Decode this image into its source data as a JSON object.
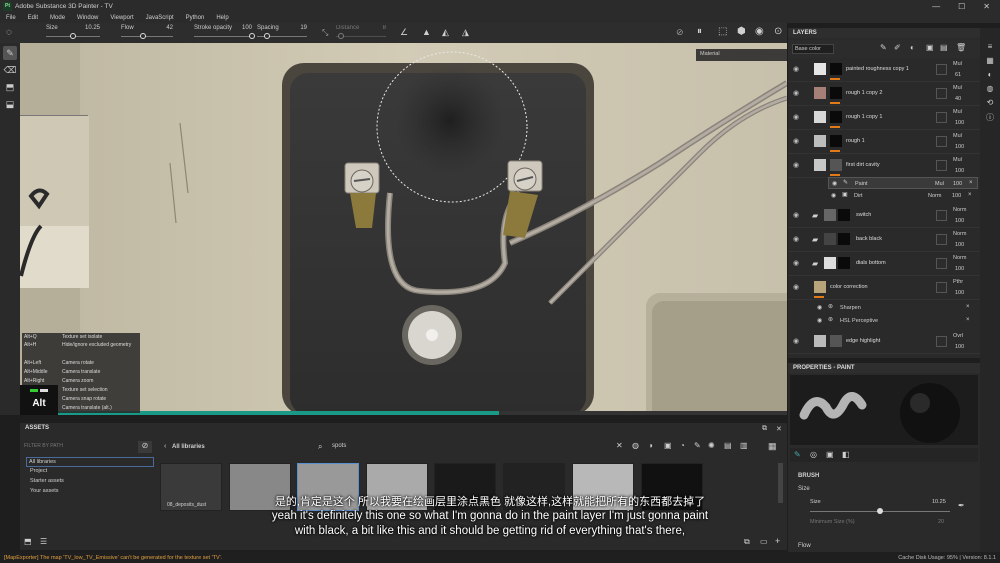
{
  "window": {
    "title": "Adobe Substance 3D Painter - TV",
    "logo": "Pt",
    "controls": [
      "—",
      "☐",
      "✕"
    ]
  },
  "menu": [
    "File",
    "Edit",
    "Mode",
    "Window",
    "Viewport",
    "JavaScript",
    "Python",
    "Help"
  ],
  "toolbar": {
    "size": {
      "label": "Size",
      "value": "10.25",
      "level": 0.5
    },
    "flow": {
      "label": "Flow",
      "value": "42",
      "level": 0.42
    },
    "stroke_opacity": {
      "label": "Stroke opacity",
      "value": "100",
      "level": 1.0
    },
    "spacing": {
      "label": "Spacing",
      "value": "19",
      "level": 0.19
    },
    "distance": {
      "label": "Distance",
      "value": "8",
      "level": 0.1
    },
    "material_label": "Material"
  },
  "layers": {
    "title": "LAYERS",
    "blend_select": "Base color",
    "items": [
      {
        "name": "painted roughness copy 1",
        "blend": "Mul",
        "opacity": "61"
      },
      {
        "name": "rough 1 copy 2",
        "blend": "Mul",
        "opacity": "40"
      },
      {
        "name": "rough 1 copy 1",
        "blend": "Mul",
        "opacity": "100"
      },
      {
        "name": "rough 1",
        "blend": "Mul",
        "opacity": "100"
      },
      {
        "name": "first dirt cavity",
        "blend": "Mul",
        "opacity": "100"
      },
      {
        "name": "Paint",
        "blend": "Mul",
        "opacity": "100"
      },
      {
        "name": "Dirt",
        "blend": "Norm",
        "opacity": "100"
      },
      {
        "name": "switch",
        "blend": "Norm",
        "opacity": "100"
      },
      {
        "name": "back black",
        "blend": "Norm",
        "opacity": "100"
      },
      {
        "name": "dials bottom",
        "blend": "Norm",
        "opacity": "100"
      },
      {
        "name": "color correction",
        "blend": "Pthr",
        "opacity": "100"
      },
      {
        "name": "Sharpen",
        "blend": "",
        "opacity": ""
      },
      {
        "name": "HSL Perceptive",
        "blend": "",
        "opacity": ""
      },
      {
        "name": "edge highlight",
        "blend": "Ovrl",
        "opacity": "100"
      }
    ]
  },
  "properties": {
    "title": "PROPERTIES - PAINT",
    "section": "BRUSH",
    "size_label": "Size",
    "size_row_label": "Size",
    "size_value": "10.25",
    "size_level": 0.5,
    "min_size_label": "Minimum Size (%)",
    "min_size_value": "20",
    "flow_label": "Flow"
  },
  "assets": {
    "title": "ASSETS",
    "filter_placeholder": "FILTER BY PATH",
    "tree": [
      "All libraries",
      "Project",
      "Starter assets",
      "Your assets"
    ],
    "breadcrumb": "All libraries",
    "search": "spots",
    "first_thumb_label": "08_deposits_dust"
  },
  "shortcuts": [
    {
      "key": "Alt+Q",
      "action": "Texture set isolate"
    },
    {
      "key": "Alt+H",
      "action": "Hide/ignore excluded geometry"
    },
    {
      "key": "Alt+Left",
      "action": "Camera rotate"
    },
    {
      "key": "Alt+Middle",
      "action": "Camera translate"
    },
    {
      "key": "Alt+Right",
      "action": "Camera zoom"
    },
    {
      "key": "",
      "action": "Texture set selection"
    },
    {
      "key": "",
      "action": "Camera snap rotate"
    },
    {
      "key": "",
      "action": "Camera translate (alt.)"
    }
  ],
  "alt_key": "Alt",
  "subtitles": {
    "zh": "是的,肯定是这个 所以我要在绘画层里涂点黑色 就像这样,这样就能把所有的东西都去掉了",
    "en1": "yeah it's definitely this one so what I'm gonna do in the paint layer I'm just gonna paint",
    "en2": "with black, a bit like this and it should be getting rid of everything that's there,"
  },
  "status": {
    "message": "[MapExporter] The map 'TV_low_TV_Emissive' can't be generated for the texture set 'TV'.",
    "right": "Cache Disk Usage:  95% | Version: 8.1.1"
  },
  "colors": {
    "accent": "#e07a1a",
    "progress": "#1a9a86",
    "status_msg": "#e0a040"
  },
  "progress_level": 0.625
}
